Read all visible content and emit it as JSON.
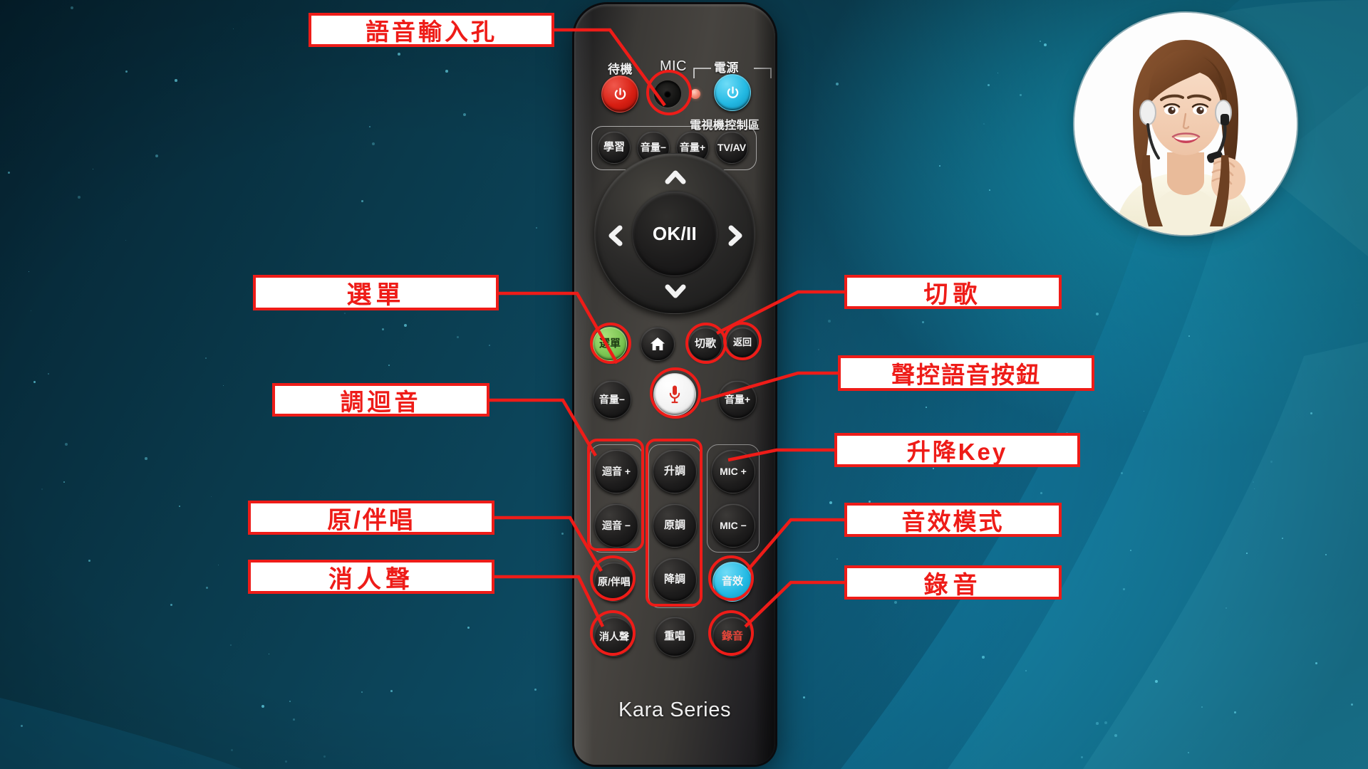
{
  "background": {
    "dark_teal": "#0a3a4c",
    "bright_cyan": "#19b4d8",
    "accent_red": "#ee1c18"
  },
  "remote": {
    "brand": "Kara Series",
    "top_labels": {
      "standby": "待機",
      "mic": "MIC",
      "power": "電源",
      "tv_control_zone": "電視機控制區"
    },
    "power_row": {
      "standby_button": "power-icon",
      "mic_port": "mic-hole",
      "ir_led": "ir-led",
      "tv_power_button": "power-icon"
    },
    "tv_row": [
      {
        "label": "學習"
      },
      {
        "label": "音量−"
      },
      {
        "label": "音量+"
      },
      {
        "label": "TV/AV"
      }
    ],
    "dpad": {
      "center": "OK/❙❙",
      "center_text": "OK/II",
      "up": "chevron-up-icon",
      "down": "chevron-down-icon",
      "left": "chevron-left-icon",
      "right": "chevron-right-icon"
    },
    "nav_row": [
      {
        "label": "選單",
        "color": "green"
      },
      {
        "label": "",
        "icon": "home-icon",
        "color": "dark"
      },
      {
        "label": "切歌",
        "color": "dark"
      },
      {
        "label": "返回",
        "color": "dark"
      }
    ],
    "volume_row": {
      "vol_down": "音量−",
      "voice_button": "microphone-icon",
      "vol_up": "音量+"
    },
    "echo_group": [
      {
        "label": "迴音 +"
      },
      {
        "label": "迴音 −"
      }
    ],
    "key_group": [
      {
        "label": "升調"
      },
      {
        "label": "原調"
      },
      {
        "label": "降調"
      }
    ],
    "mic_group": [
      {
        "label": "MIC +"
      },
      {
        "label": "MIC −"
      }
    ],
    "bottom_left": [
      {
        "label": "原/伴唱"
      },
      {
        "label": "消人聲"
      }
    ],
    "bottom_mid": [
      {
        "label": "重唱"
      }
    ],
    "bottom_right": [
      {
        "label": "音效",
        "color": "cyan"
      },
      {
        "label": "錄音",
        "color": "red-text"
      }
    ]
  },
  "callouts": {
    "left": [
      {
        "id": "voice-input-hole",
        "text": "語音輸入孔"
      },
      {
        "id": "menu",
        "text": "選單"
      },
      {
        "id": "echo-adjust",
        "text": "調迴音"
      },
      {
        "id": "original-accompaniment",
        "text": "原/伴唱"
      },
      {
        "id": "vocal-removal",
        "text": "消人聲"
      }
    ],
    "right": [
      {
        "id": "skip-song",
        "text": "切歌"
      },
      {
        "id": "voice-control-button",
        "text": "聲控語音按鈕"
      },
      {
        "id": "key-shift",
        "text": "升降Key"
      },
      {
        "id": "sound-effect-mode",
        "text": "音效模式"
      },
      {
        "id": "record",
        "text": "錄音"
      }
    ]
  },
  "avatar": {
    "alt": "customer-service-representative-with-headset"
  }
}
